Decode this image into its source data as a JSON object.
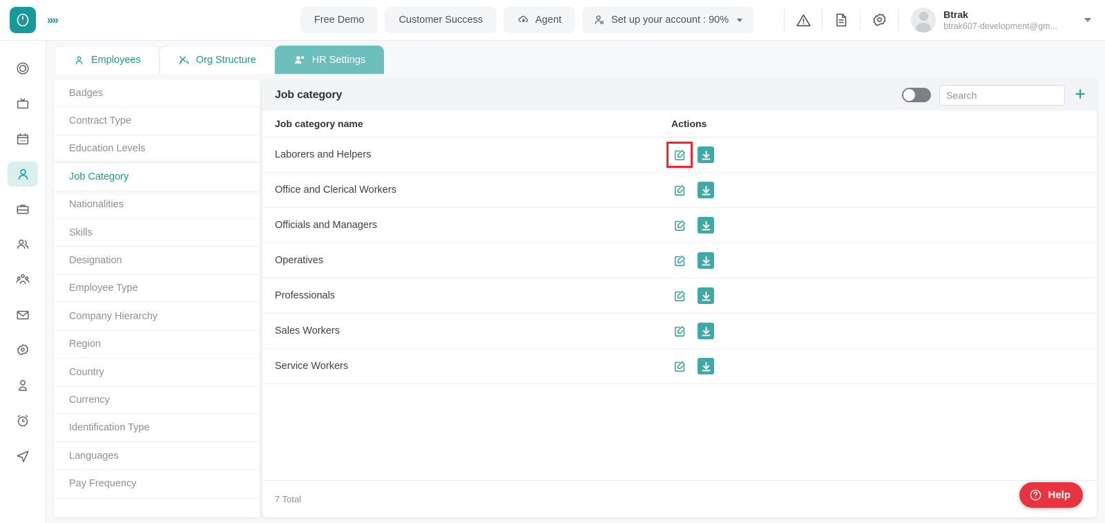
{
  "topbar": {
    "logo_icon": "clock-logo-icon",
    "expand_icon": "chevrons-right-icon",
    "buttons": [
      {
        "label": "Free Demo",
        "icon": null
      },
      {
        "label": "Customer Success",
        "icon": null
      },
      {
        "label": "Agent",
        "icon": "cloud-download-icon"
      }
    ],
    "setup": {
      "label": "Set up your account : 90%",
      "icon": "user-settings-icon"
    },
    "icons": [
      "warning-triangle-icon",
      "document-icon",
      "gear-icon"
    ],
    "user": {
      "name": "Btrak",
      "email": "btrak607-development@gm...",
      "avatar": "user-avatar"
    }
  },
  "rail": {
    "items": [
      {
        "name": "dashboard-icon",
        "active": false
      },
      {
        "name": "tv-screen-icon",
        "active": false
      },
      {
        "name": "calendar-icon",
        "active": false
      },
      {
        "name": "person-icon",
        "active": true
      },
      {
        "name": "briefcase-icon",
        "active": false
      },
      {
        "name": "people-icon",
        "active": false
      },
      {
        "name": "group-icon",
        "active": false
      },
      {
        "name": "mail-icon",
        "active": false
      },
      {
        "name": "settings-gear-icon",
        "active": false
      },
      {
        "name": "profile-icon",
        "active": false
      },
      {
        "name": "alarm-clock-icon",
        "active": false
      },
      {
        "name": "send-icon",
        "active": false
      }
    ]
  },
  "tabs": [
    {
      "label": "Employees",
      "icon": "user-outline-icon",
      "active": false
    },
    {
      "label": "Org Structure",
      "icon": "tools-icon",
      "active": false
    },
    {
      "label": "HR Settings",
      "icon": "users-gear-icon",
      "active": true
    }
  ],
  "settings_menu": {
    "items": [
      {
        "label": "Badges",
        "selected": false
      },
      {
        "label": "Contract Type",
        "selected": false
      },
      {
        "label": "Education Levels",
        "selected": false
      },
      {
        "label": "Job Category",
        "selected": true
      },
      {
        "label": "Nationalities",
        "selected": false
      },
      {
        "label": "Skills",
        "selected": false
      },
      {
        "label": "Designation",
        "selected": false
      },
      {
        "label": "Employee Type",
        "selected": false
      },
      {
        "label": "Company Hierarchy",
        "selected": false
      },
      {
        "label": "Region",
        "selected": false
      },
      {
        "label": "Country",
        "selected": false
      },
      {
        "label": "Currency",
        "selected": false
      },
      {
        "label": "Identification Type",
        "selected": false
      },
      {
        "label": "Languages",
        "selected": false
      },
      {
        "label": "Pay Frequency",
        "selected": false
      }
    ]
  },
  "card": {
    "title": "Job category",
    "toggle": {
      "name": "archived-toggle",
      "state": "off"
    },
    "search": {
      "placeholder": "Search",
      "value": ""
    },
    "add_button": "+",
    "columns": [
      "Job category name",
      "Actions"
    ],
    "rows": [
      {
        "name": "Laborers and Helpers",
        "edit_highlighted": true
      },
      {
        "name": "Office and Clerical Workers",
        "edit_highlighted": false
      },
      {
        "name": "Officials and Managers",
        "edit_highlighted": false
      },
      {
        "name": "Operatives",
        "edit_highlighted": false
      },
      {
        "name": "Professionals",
        "edit_highlighted": false
      },
      {
        "name": "Sales Workers",
        "edit_highlighted": false
      },
      {
        "name": "Service Workers",
        "edit_highlighted": false
      }
    ],
    "footer_total": "7 Total",
    "actions": {
      "edit_icon": "edit-pencil-icon",
      "archive_icon": "download-arrow-icon"
    }
  },
  "help": {
    "label": "Help",
    "icon": "question-circle-icon"
  },
  "colors": {
    "accent_teal": "#179a99",
    "tab_active": "#6cbfbc",
    "action_teal": "#2a9d9b",
    "highlight_red": "#f5232c",
    "help_red": "#e8343f"
  }
}
